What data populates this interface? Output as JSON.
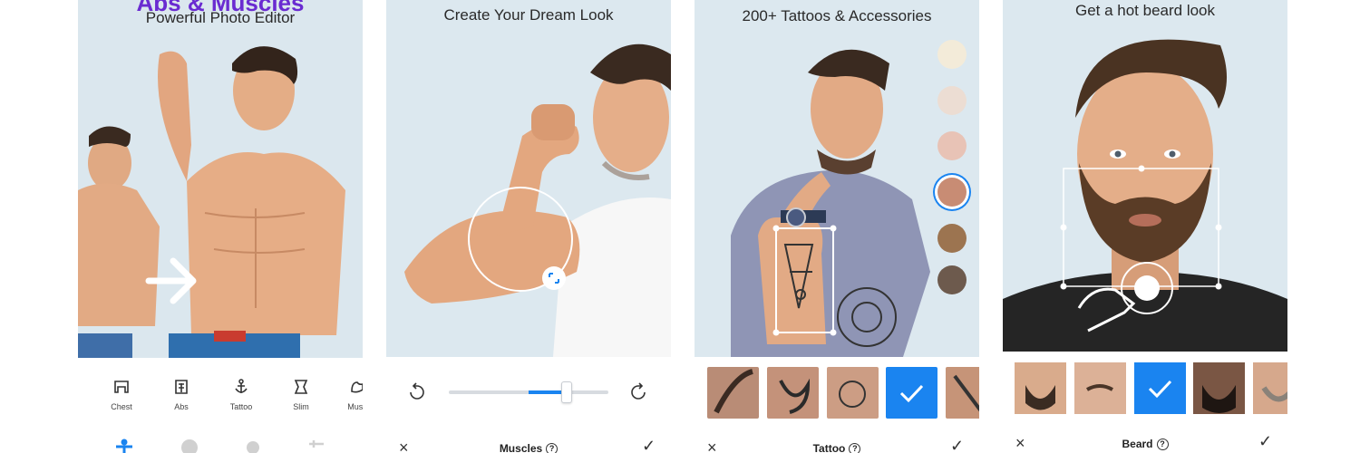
{
  "panel1": {
    "headline": "Abs & Muscles",
    "subtitle": "Powerful Photo Editor",
    "tools": [
      {
        "label": "Chest",
        "icon": "chest-icon"
      },
      {
        "label": "Abs",
        "icon": "abs-icon"
      },
      {
        "label": "Tattoo",
        "icon": "anchor-icon"
      },
      {
        "label": "Slim",
        "icon": "slim-icon"
      },
      {
        "label": "Musc",
        "icon": "muscles-icon"
      }
    ],
    "bottom_icons": [
      "body-icon",
      "face-icon",
      "hair-icon",
      "adjust-icon"
    ],
    "accent": "#6a2bd1"
  },
  "panel2": {
    "subtitle": "Create Your Dream Look",
    "toolbar_title": "Muscles",
    "help": "?",
    "slider": {
      "value": 0.7,
      "accent": "#1a84f0"
    }
  },
  "panel3": {
    "subtitle": "200+ Tattoos & Accessories",
    "toolbar_title": "Tattoo",
    "help": "?",
    "swatches": [
      "#f3ebd9",
      "#ecddd3",
      "#e8c3b6",
      "#c88c74",
      "#9c7450",
      "#6d5a4d"
    ],
    "selected_swatch": 3,
    "selected_thumb": 3
  },
  "panel4": {
    "subtitle": "Get a hot beard look",
    "toolbar_title": "Beard",
    "help": "?",
    "selected_thumb": 2
  },
  "icons": {
    "close": "×",
    "check": "✓"
  }
}
